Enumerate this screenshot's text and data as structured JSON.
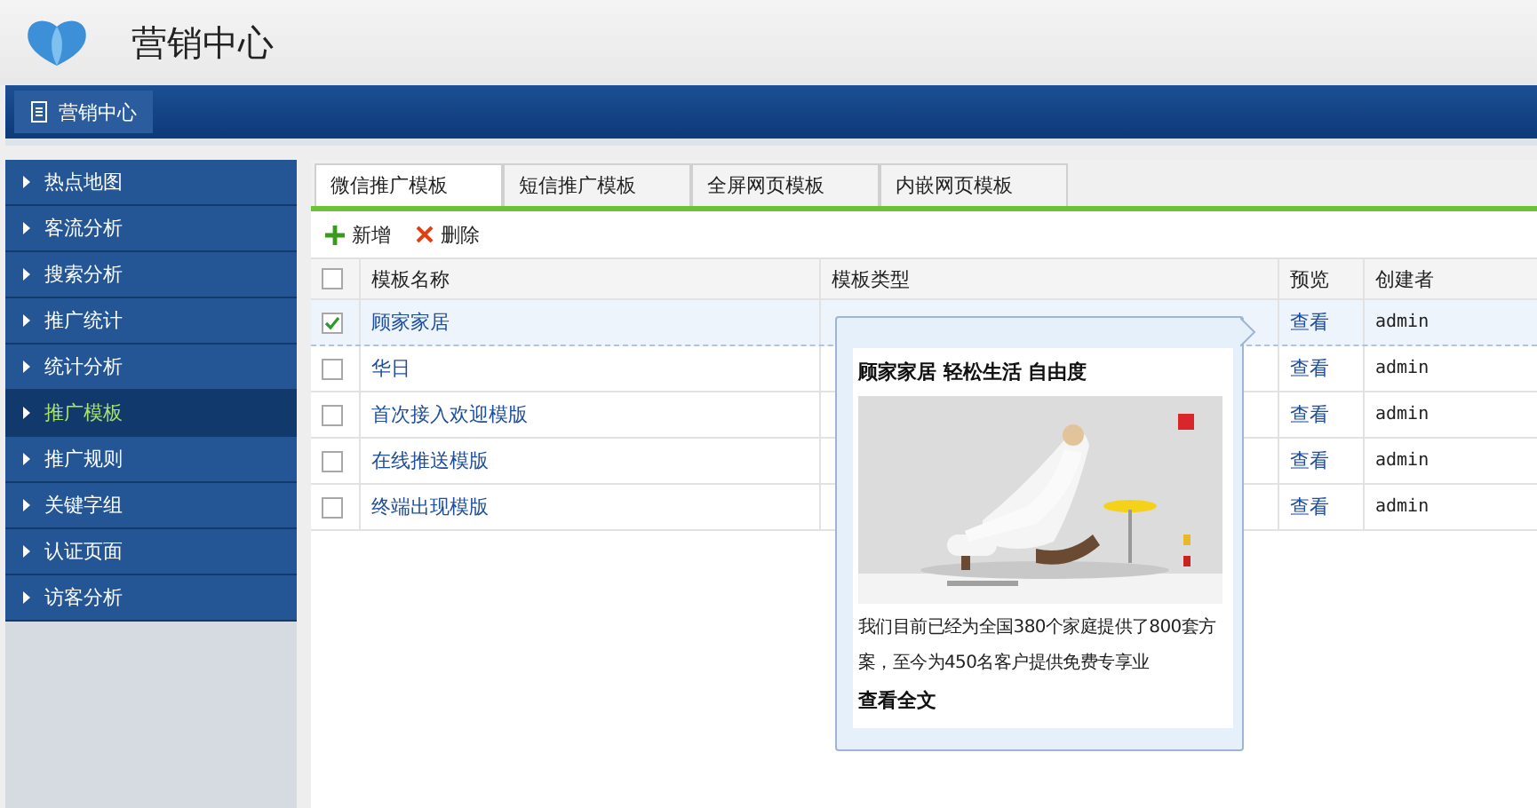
{
  "app": {
    "title": "营销中心"
  },
  "nav": {
    "items": [
      {
        "label": "营销中心",
        "selected": true
      }
    ]
  },
  "sidebar": {
    "items": [
      {
        "label": "热点地图",
        "selected": false
      },
      {
        "label": "客流分析",
        "selected": false
      },
      {
        "label": "搜索分析",
        "selected": false
      },
      {
        "label": "推广统计",
        "selected": false
      },
      {
        "label": "统计分析",
        "selected": false
      },
      {
        "label": "推广模板",
        "selected": true
      },
      {
        "label": "推广规则",
        "selected": false
      },
      {
        "label": "关键字组",
        "selected": false
      },
      {
        "label": "认证页面",
        "selected": false
      },
      {
        "label": "访客分析",
        "selected": false
      }
    ]
  },
  "tabs": [
    {
      "label": "微信推广模板",
      "selected": true
    },
    {
      "label": "短信推广模板",
      "selected": false
    },
    {
      "label": "全屏网页模板",
      "selected": false
    },
    {
      "label": "内嵌网页模板",
      "selected": false
    }
  ],
  "toolbar": [
    {
      "kind": "add",
      "label": "新增"
    },
    {
      "kind": "delete",
      "label": "删除"
    }
  ],
  "table": {
    "columns": [
      "模板名称",
      "模板类型",
      "预览",
      "创建者"
    ],
    "header_checked": false,
    "rows": [
      {
        "checked": true,
        "name": "顾家家居",
        "preview": "查看",
        "creator": "admin"
      },
      {
        "checked": false,
        "name": "华日",
        "preview": "查看",
        "creator": "admin"
      },
      {
        "checked": false,
        "name": "首次接入欢迎模版",
        "preview": "查看",
        "creator": "admin"
      },
      {
        "checked": false,
        "name": "在线推送模版",
        "preview": "查看",
        "creator": "admin"
      },
      {
        "checked": false,
        "name": "终端出现模版",
        "preview": "查看",
        "creator": "admin"
      }
    ]
  },
  "popup": {
    "title": "顾家家居 轻松生活 自由度",
    "text": "我们目前已经为全国380个家庭提供了800套方案，至今为450名客户提供免费专享业",
    "link": "查看全文"
  }
}
